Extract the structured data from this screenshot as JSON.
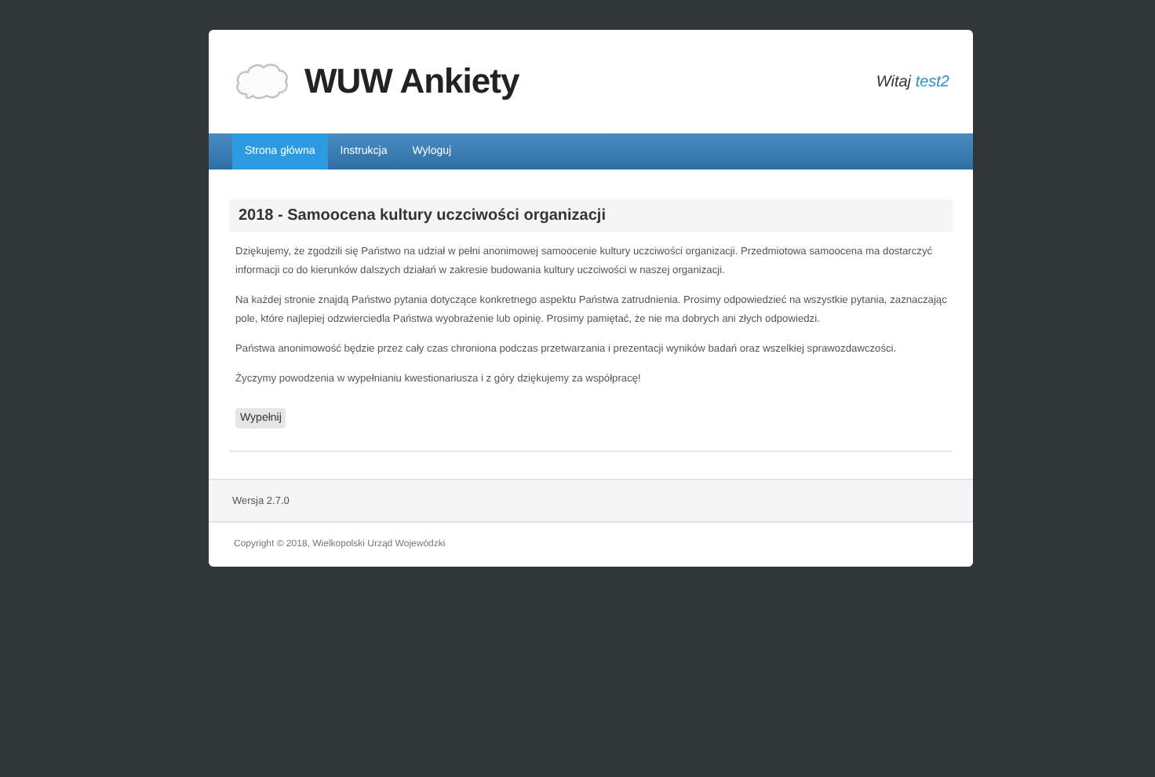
{
  "header": {
    "title": "WUW Ankiety",
    "greeting": "Witaj",
    "username": "test2"
  },
  "nav": [
    {
      "label": "Strona główna",
      "selected": true
    },
    {
      "label": "Instrukcja",
      "selected": false
    },
    {
      "label": "Wyloguj",
      "selected": false
    }
  ],
  "survey": {
    "title": "2018 - Samoocena kultury uczciwości organizacji",
    "paragraphs": [
      "Dziękujemy, że zgodzili się Państwo na udział w pełni anonimowej samoocenie kultury uczciwości organizacji. Przedmiotowa samoocena ma dostarczyć informacji co do kierunków dalszych działań w zakresie budowania kultury uczciwości w naszej organizacji.",
      "Na każdej stronie znajdą Państwo pytania dotyczące konkretnego aspektu Państwa zatrudnienia. Prosimy odpowiedzieć na wszystkie pytania, zaznaczając pole, które najlepiej odzwierciedla Państwa wyobrażenie lub opinię.  Prosimy pamiętać, że nie ma dobrych ani złych odpowiedzi.",
      "Państwa anonimowość będzie przez cały czas chroniona podczas przetwarzania i prezentacji wyników badań oraz wszelkiej sprawozdawczości.",
      "Życzymy powodzenia w wypełnianiu kwestionariusza i z góry dziękujemy za współpracę!"
    ],
    "button": "Wypełnij"
  },
  "version": "Wersja 2.7.0",
  "copyright": "Copyright © 2018, Wielkopolski Urząd Wojewódzki"
}
